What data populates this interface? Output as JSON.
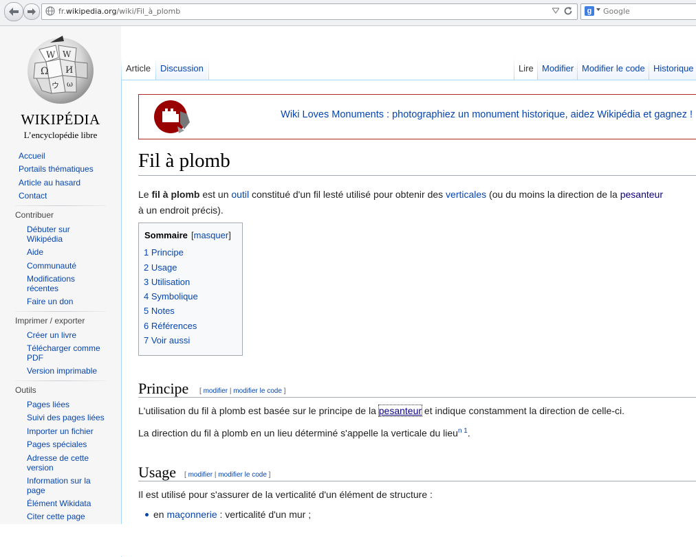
{
  "browser": {
    "url_domain": "fr.",
    "url_host": "wikipedia.org",
    "url_path": "/wiki/Fil_à_plomb",
    "search_placeholder": "Google",
    "search_engine_letter": "g"
  },
  "logo": {
    "wordmark": "WIKIPÉDIA",
    "tagline": "L’encyclopédie libre"
  },
  "sidebar": {
    "main": [
      "Accueil",
      "Portails thématiques",
      "Article au hasard",
      "Contact"
    ],
    "contribuer": {
      "heading": "Contribuer",
      "items": [
        "Débuter sur Wikipédia",
        "Aide",
        "Communauté",
        "Modifications récentes",
        "Faire un don"
      ]
    },
    "imprimer": {
      "heading": "Imprimer / exporter",
      "items": [
        "Créer un livre",
        "Télécharger comme PDF",
        "Version imprimable"
      ]
    },
    "outils": {
      "heading": "Outils",
      "items": [
        "Pages liées",
        "Suivi des pages liées",
        "Importer un fichier",
        "Pages spéciales",
        "Adresse de cette version",
        "Information sur la page",
        "Élément Wikidata",
        "Citer cette page"
      ]
    }
  },
  "tabs": {
    "left": [
      "Article",
      "Discussion"
    ],
    "right": [
      "Lire",
      "Modifier",
      "Modifier le code",
      "Historique"
    ]
  },
  "banner": {
    "text": "Wiki Loves Monuments : photographiez un monument historique, aidez Wikipédia et gagnez !"
  },
  "article": {
    "title": "Fil à plomb",
    "intro": {
      "p1": "Le ",
      "bold": "fil à plomb",
      "p2": " est un ",
      "link1": "outil",
      "p3": " constitué d'un fil lesté utilisé pour obtenir des ",
      "link2": "verticales",
      "p4": " (ou du moins la direction de la ",
      "link3": "pesanteur",
      "line2": "à un endroit précis)."
    },
    "toc": {
      "title": "Sommaire",
      "toggle_open": "[",
      "toggle_label": "masquer",
      "toggle_close": "]",
      "items": [
        "1 Principe",
        "2 Usage",
        "3 Utilisation",
        "4 Symbolique",
        "5 Notes",
        "6 Références",
        "7 Voir aussi"
      ]
    },
    "sections": {
      "principe": {
        "heading": "Principe",
        "edit_open": "[ ",
        "edit1": "modifier",
        "edit_sep": " | ",
        "edit2": "modifier le code",
        "edit_close": " ]",
        "p1_a": "L'utilisation du fil à plomb est basée sur le principe de la ",
        "p1_link": "pesanteur",
        "p1_b": " et indique constamment la direction de celle-ci.",
        "p2": "La direction du fil à plomb en un lieu déterminé s'appelle la verticale du lieu",
        "p2_note": "n 1",
        "p2_end": "."
      },
      "usage": {
        "heading": "Usage",
        "edit_open": "[ ",
        "edit1": "modifier",
        "edit_sep": " | ",
        "edit2": "modifier le code",
        "edit_close": " ]",
        "p1": "Il est utilisé pour s'assurer de la verticalité d'un élément de structure :",
        "li1_a": "en ",
        "li1_link": "maçonnerie",
        "li1_b": " : verticalité d'un mur ;"
      }
    }
  }
}
